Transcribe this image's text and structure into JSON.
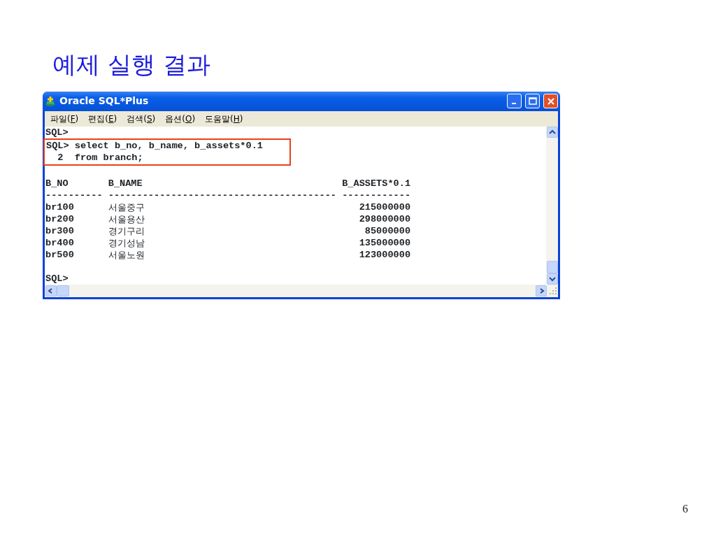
{
  "slide": {
    "title": "예제 실행 결과",
    "page_number": "6"
  },
  "window": {
    "title": "Oracle SQL*Plus",
    "menu": [
      {
        "before": "파일(",
        "key": "F",
        "after": ")"
      },
      {
        "before": "편집(",
        "key": "E",
        "after": ")"
      },
      {
        "before": "검색(",
        "key": "S",
        "after": ")"
      },
      {
        "before": "옵션(",
        "key": "O",
        "after": ")"
      },
      {
        "before": "도움말(",
        "key": "H",
        "after": ")"
      }
    ],
    "console": {
      "pre_lines": [
        "SQL>"
      ],
      "highlighted_lines": [
        "SQL> select b_no, b_name, b_assets*0.1",
        "  2  from branch;"
      ],
      "table": {
        "columns": [
          {
            "header": "B_NO",
            "rule": "----------"
          },
          {
            "header": "B_NAME",
            "rule": "----------------------------------------"
          },
          {
            "header": "B_ASSETS*0.1",
            "rule": "------------"
          }
        ],
        "rows": [
          [
            "br100",
            "서울중구",
            "215000000"
          ],
          [
            "br200",
            "서울용산",
            "298000000"
          ],
          [
            "br300",
            "경기구리",
            "85000000"
          ],
          [
            "br400",
            "경기성남",
            "135000000"
          ],
          [
            "br500",
            "서울노원",
            "123000000"
          ]
        ]
      },
      "post_lines": [
        "SQL>"
      ]
    }
  }
}
